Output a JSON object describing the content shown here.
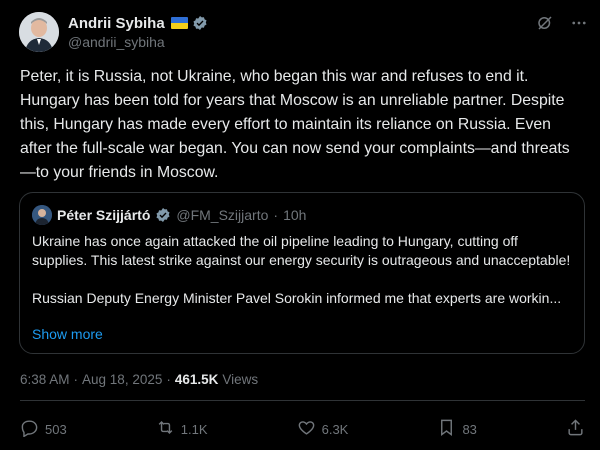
{
  "author": {
    "name": "Andrii Sybiha",
    "handle": "@andrii_sybiha"
  },
  "post": {
    "text": "Peter, it is Russia, not Ukraine, who began this war and refuses to end it. Hungary has been told for years that Moscow is an unreliable partner. Despite this, Hungary has made every effort to maintain its reliance on Russia. Even after the full-scale war began. You can now send your complaints—and threats—to your friends in Moscow."
  },
  "quote": {
    "name": "Péter Szijjártó",
    "handle": "@FM_Szijjarto",
    "separator": "·",
    "time": "10h",
    "paragraph1": "Ukraine has once again attacked the oil pipeline leading to Hungary, cutting off supplies. This latest strike against our energy security is outrageous and unacceptable!",
    "paragraph2": "Russian Deputy Energy Minister Pavel Sorokin informed me that experts are workin...",
    "show_more": "Show more"
  },
  "meta": {
    "time": "6:38 AM",
    "separator1": "·",
    "date": "Aug 18, 2025",
    "separator2": "·",
    "views_count": "461.5K",
    "views_label": "Views"
  },
  "actions": {
    "replies": "503",
    "reposts": "1.1K",
    "likes": "6.3K",
    "bookmarks": "83"
  },
  "colors": {
    "background": "#000000",
    "text": "#e7e9ea",
    "muted": "#71767b",
    "link": "#1d9bf0",
    "border": "#2f3336",
    "verified": "#829aab"
  },
  "icons": [
    "verified-badge-icon",
    "flag-ukraine-icon",
    "grok-icon",
    "more-icon",
    "reply-icon",
    "repost-icon",
    "like-icon",
    "bookmark-icon",
    "share-icon"
  ]
}
